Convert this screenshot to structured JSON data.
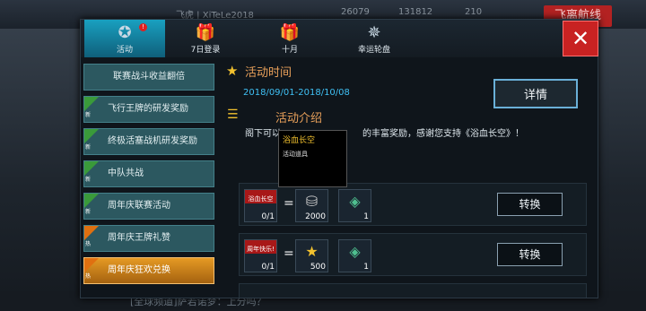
{
  "background": {
    "player_name": "飞虎 | XiTeLe2018",
    "currency_1": "26079",
    "currency_2": "131812",
    "currency_3": "210",
    "exit_label": "飞离航线",
    "chat_text": "[全球频道]萨若诺梦：上分吗？"
  },
  "tabs": [
    {
      "label": "活动",
      "icon": "star-badge-icon",
      "badge": "!"
    },
    {
      "label": "7日登录",
      "icon": "gift-icon"
    },
    {
      "label": "十月",
      "icon": "gift-icon"
    },
    {
      "label": "幸运轮盘",
      "icon": "wheel-icon"
    }
  ],
  "close_label": "✕",
  "sidebar": {
    "items": [
      {
        "label": "联赛战斗收益翻倍",
        "tag": "",
        "tag_color": ""
      },
      {
        "label": "飞行王牌的研发奖励",
        "tag": "新",
        "tag_color": "#3a9a3a"
      },
      {
        "label": "终极活塞战机研发奖励",
        "tag": "新",
        "tag_color": "#3a9a3a"
      },
      {
        "label": "中队共战",
        "tag": "新",
        "tag_color": "#3a9a3a"
      },
      {
        "label": "周年庆联赛活动",
        "tag": "新",
        "tag_color": "#3a9a3a"
      },
      {
        "label": "周年庆王牌礼赞",
        "tag": "热",
        "tag_color": "#e07010"
      },
      {
        "label": "周年庆狂欢兑换",
        "tag": "热",
        "tag_color": "#e07010",
        "active": true
      }
    ]
  },
  "content": {
    "time_title": "活动时间",
    "date_range": "2018/09/01-2018/10/08",
    "detail_button": "详情",
    "intro_title": "活动介绍",
    "desc_prefix": "阁下可以",
    "desc_suffix": "的丰富奖励，感谢您支持《浴血长空》！",
    "tooltip_title": "浴血长空",
    "tooltip_sub": "活动道具",
    "rows": [
      {
        "card_text": "浴血长空",
        "card_count": "0/1",
        "reward1_count": "2000",
        "reward1_icon": "coin-stack-icon",
        "reward2_count": "1",
        "reward2_icon": "crate-icon",
        "button": "转换"
      },
      {
        "card_text": "周年快乐!",
        "card_count": "0/1",
        "reward1_count": "500",
        "reward1_icon": "gold-star-icon",
        "reward2_count": "1",
        "reward2_icon": "crate-icon",
        "button": "转换"
      }
    ],
    "equals": "="
  },
  "colors": {
    "accent": "#19a0c0",
    "close": "#c82222",
    "active_item": "#e59a24",
    "date": "#3fc0f4",
    "title": "#e8a05a"
  }
}
